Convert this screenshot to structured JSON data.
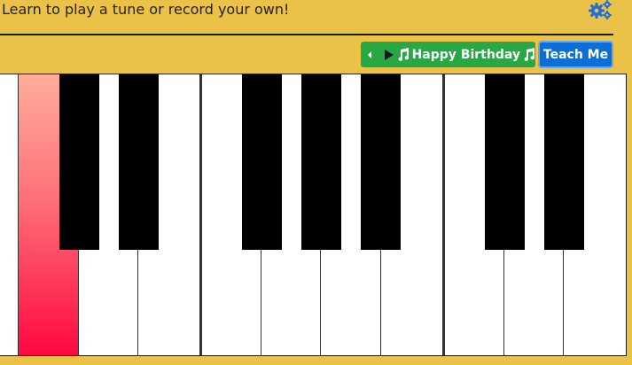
{
  "header": {
    "instruction": "Learn to play a tune or record your own!",
    "settings_icon": "gears-icon"
  },
  "controls": {
    "song_title": "Happy Birthday",
    "prev_icon": "caret-left-icon",
    "play_icon": "play-icon",
    "music_icon": "music-note-icon",
    "teach_label": "Teach Me"
  },
  "colors": {
    "background": "#ebc248",
    "play_button": "#28a745",
    "teach_button": "#0d6fd6",
    "active_key_top": "#ffae9a",
    "active_key_bottom": "#ff0841"
  },
  "keyboard": {
    "white_key_count": 11,
    "black_key_count": 7,
    "active_white_key_index": 0
  }
}
